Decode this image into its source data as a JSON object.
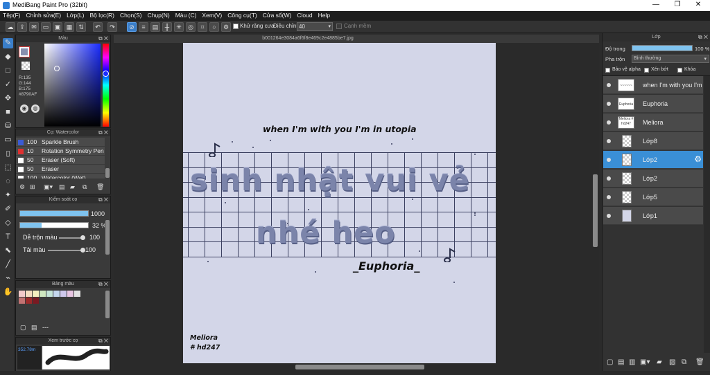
{
  "window": {
    "title": "MediBang Paint Pro (32bit)",
    "minimize": "—",
    "maximize": "❐",
    "close": "✕"
  },
  "menu": [
    "Tệp(F)",
    "Chỉnh sửa(E)",
    "Lớp(L)",
    "Bộ lọc(R)",
    "Chọn(S)",
    "Chụp(N)",
    "Màu (C)",
    "Xem(V)",
    "Công cụ(T)",
    "Cửa sổ(W)",
    "Cloud",
    "Help"
  ],
  "toolbar": {
    "antialias_label": "Khử răng cưa",
    "adjust_label": "Điều chỉnh",
    "adjust_value": "40",
    "edge_label": "Cạnh mềm"
  },
  "color_panel": {
    "title": "Màu",
    "r": "R:135",
    "g": "G:144",
    "b": "B:175",
    "hex": "#8790AF",
    "current_color": "#8790af"
  },
  "brush_panel": {
    "title": "Cọ: Watercolor",
    "brushes": [
      {
        "size": "100",
        "name": "Sparkle Brush",
        "color": "#3b5bd6"
      },
      {
        "size": "10",
        "name": "Rotation Symmetry Pen",
        "color": "#e03030"
      },
      {
        "size": "50",
        "name": "Eraser (Soft)",
        "color": "#ffffff"
      },
      {
        "size": "50",
        "name": "Eraser",
        "color": "#ffffff"
      },
      {
        "size": "100",
        "name": "Watercolor (Wet)",
        "color": "#ffffff"
      }
    ]
  },
  "brush_control": {
    "title": "Kiểm soát cọ",
    "size": "1000",
    "opacity": "32 %",
    "opacity_fraction": 0.32,
    "blend_label": "Dễ trộn màu",
    "blend_value": "100",
    "reload_label": "Tải màu",
    "reload_value": "100"
  },
  "palette": {
    "title": "Bảng màu",
    "swatches": [
      "#f2c9c9",
      "#f4dcc0",
      "#f3efbf",
      "#cfe8c0",
      "#c4e4d8",
      "#c4d7ee",
      "#cfc8ec",
      "#e8c6e2",
      "#e2e2e2",
      "#c27272",
      "#9c2a2a",
      "#7a1a22"
    ],
    "footer": "---"
  },
  "preview": {
    "title": "Xem trước cọ",
    "size": "352.78m"
  },
  "document": {
    "filename": "b001264e3084a6f6f8e469c2e4885be7.jpg"
  },
  "artwork": {
    "caption": "when I'm with you I'm in utopia",
    "line1": "sinh nhật vui vẻ",
    "line2": "nhé heo",
    "signature": "_Euphoria_",
    "credit1": "Meliora",
    "credit2": "# hd247"
  },
  "layer_panel": {
    "title": "Lớp",
    "opacity_label": "Độ trong",
    "opacity_value": "100 %",
    "opacity_fraction": 1.0,
    "blend_label": "Pha trộn",
    "blend_value": "Bình thường",
    "protect_alpha": "Bảo vệ alpha",
    "clipping": "Xén bớt",
    "lock": "Khóa",
    "layers": [
      {
        "name": "when I'm with you I'm",
        "thumb": "~~~~~~",
        "selected": false
      },
      {
        "name": "Euphoria",
        "thumb": "Euphoria",
        "selected": false
      },
      {
        "name": "Meliora",
        "thumb": "Meliora # hd247",
        "selected": false
      },
      {
        "name": "Lớp8",
        "thumb": "",
        "selected": false
      },
      {
        "name": "Lớp2",
        "thumb": "",
        "selected": true
      },
      {
        "name": "Lớp2",
        "thumb": "",
        "selected": false
      },
      {
        "name": "Lớp5",
        "thumb": "",
        "selected": false
      },
      {
        "name": "Lớp1",
        "thumb": "",
        "selected": false
      }
    ]
  }
}
